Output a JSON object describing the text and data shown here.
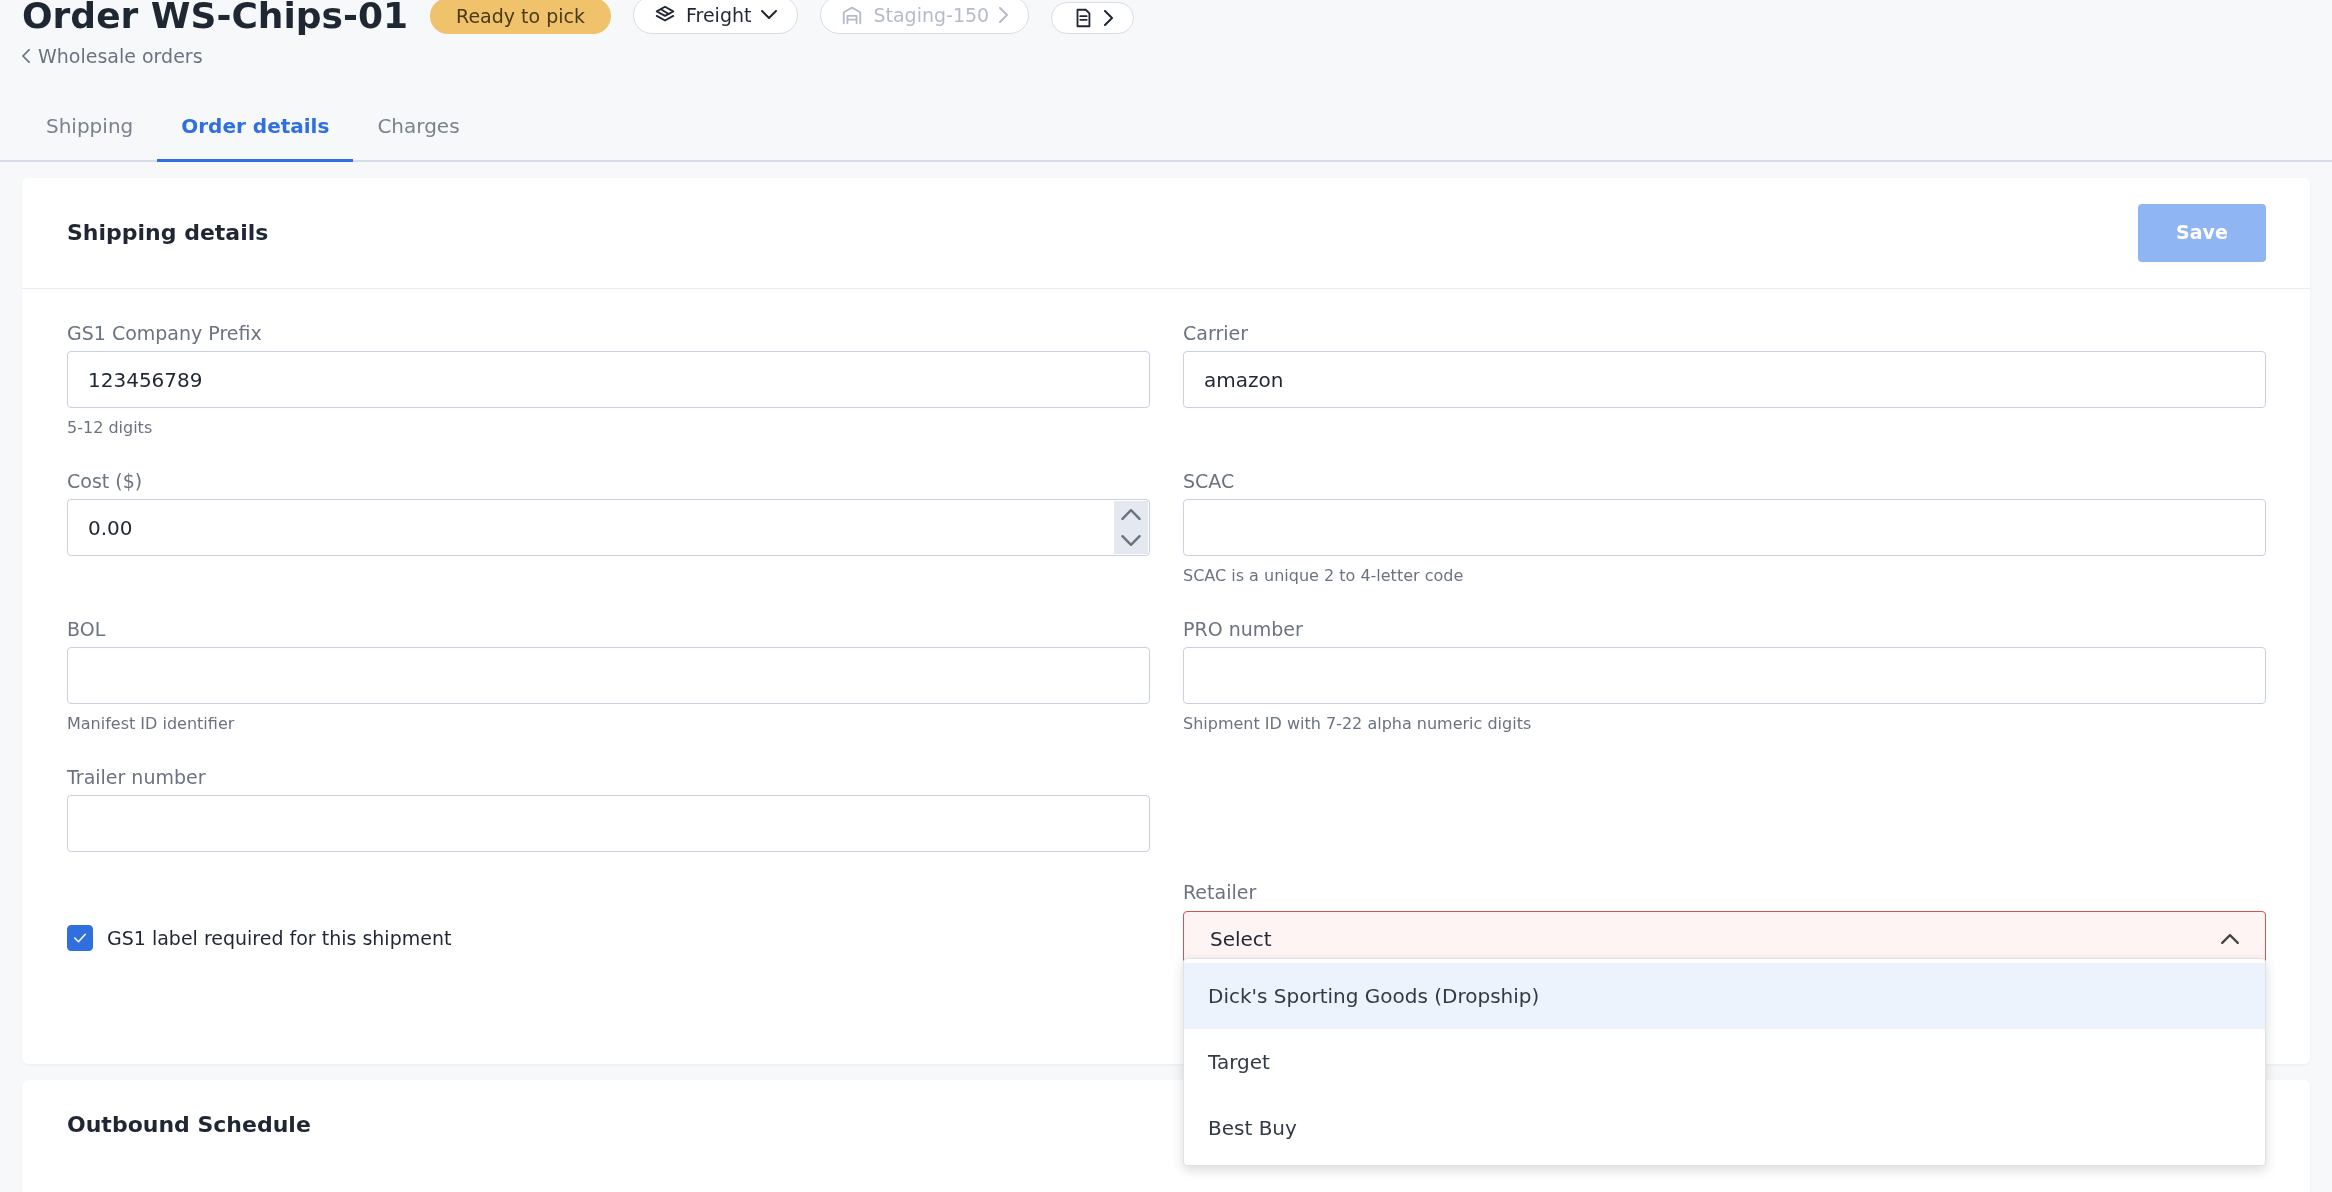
{
  "header": {
    "title": "Order WS-Chips-01",
    "status": "Ready to pick",
    "chips": [
      {
        "kind": "menu",
        "label": "Freight",
        "disabled": false
      },
      {
        "kind": "menu",
        "label": "Staging-150",
        "disabled": true
      },
      {
        "kind": "icon",
        "disabled": false
      }
    ]
  },
  "breadcrumb": "Wholesale orders",
  "tabs": [
    {
      "label": "Shipping",
      "selected": false
    },
    {
      "label": "Order details",
      "selected": true
    },
    {
      "label": "Charges",
      "selected": false
    }
  ],
  "shipping_details": {
    "title": "Shipping details",
    "save_button": {
      "label": "Save",
      "disabled": true
    },
    "rows": [
      {
        "left": {
          "kind": "text",
          "label": "GS1 Company Prefix",
          "value": "123456789",
          "help": "5-12 digits"
        },
        "right": {
          "kind": "text",
          "label": "Carrier",
          "value": "amazon"
        }
      },
      {
        "left": {
          "kind": "number",
          "label": "Cost ($)",
          "value": "0.00"
        },
        "right": {
          "kind": "text",
          "label": "SCAC",
          "help": "SCAC is a unique 2 to 4-letter code"
        }
      },
      {
        "left": {
          "kind": "text",
          "label": "BOL",
          "help": "Manifest ID identifier"
        },
        "right": {
          "kind": "text",
          "label": "PRO number",
          "help": "Shipment ID with 7-22 alpha numeric digits"
        }
      },
      {
        "left": {
          "kind": "text",
          "label": "Trailer number"
        }
      },
      {
        "left": {
          "kind": "checkbox",
          "label": "GS1 label required for this shipment",
          "checked": true
        },
        "right": {
          "kind": "select",
          "label": "Retailer",
          "placeholder": "Select",
          "invalid": true,
          "expanded": true,
          "options": [
            {
              "label": "Dick's Sporting Goods (Dropship)",
              "highlighted": true
            },
            {
              "label": "Target",
              "highlighted": false
            },
            {
              "label": "Best Buy",
              "highlighted": false
            }
          ]
        }
      }
    ]
  },
  "outbound_schedule": {
    "title": "Outbound Schedule"
  }
}
